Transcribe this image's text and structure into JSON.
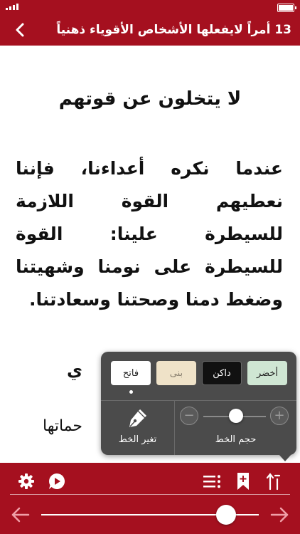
{
  "nav": {
    "title": "13 أمراً لايفعلها الأشخاص الأقوياء ذهنياً",
    "back_icon": "chevron-left-icon"
  },
  "content": {
    "heading": "لا يتخلون عن قوتهم",
    "paragraph": "عندما نكره أعداءنا، فإننا نعطيهم القوة اللازمة للسيطرة علينا: القوة للسيطرة على نومنا وشهيتنا وضغط دمنا وصحتنا وسعادتنا.",
    "partial_line_1": "ي",
    "partial_line_2": "حماتها"
  },
  "popover": {
    "themes": [
      {
        "label": "فاتح",
        "color": "#ffffff",
        "selected": true
      },
      {
        "label": "بنى",
        "color": "#efe2c8",
        "selected": false
      },
      {
        "label": "داكن",
        "color": "#111111",
        "selected": false
      },
      {
        "label": "أخضر",
        "color": "#cfe6d3",
        "selected": false
      }
    ],
    "change_font_label": "تغير الخط",
    "font_size_label": "حجم الخط",
    "font_size_level": 0.45,
    "minus_symbol": "−",
    "plus_symbol": "+"
  },
  "toolbar": {
    "icons": [
      "settings-icon",
      "audio-chat-icon",
      "list-icon",
      "bookmark-add-icon",
      "text-direction-icon"
    ],
    "reading_progress": 0.83
  },
  "colors": {
    "brand": "#a5101f",
    "popover_bg": "#4b4b4b"
  }
}
